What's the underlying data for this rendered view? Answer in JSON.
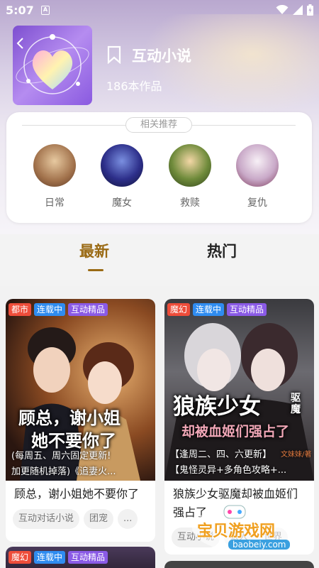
{
  "status": {
    "time": "5:07",
    "a_badge": "A"
  },
  "header": {
    "title": "互动小说",
    "count": "186本作品"
  },
  "recommend": {
    "title": "相关推荐",
    "items": [
      {
        "label": "日常"
      },
      {
        "label": "魔女"
      },
      {
        "label": "救赎"
      },
      {
        "label": "复仇"
      }
    ]
  },
  "tabs": {
    "latest": "最新",
    "hot": "热门"
  },
  "cards": [
    {
      "tags": [
        "都市",
        "连载中",
        "互动精品"
      ],
      "cover_title_1": "顾总，谢小姐",
      "cover_title_2": "她不要你了",
      "cover_sub_1": "(每周五、周六固定更新!",
      "cover_sub_2": "加更随机掉落)《追妻火...",
      "title": "顾总，谢小姐她不要你了",
      "chips": [
        "互动对话小说",
        "团宠",
        "..."
      ]
    },
    {
      "tags": [
        "魔幻",
        "连载中",
        "互动精品"
      ],
      "cover_title_1": "狼族少女",
      "cover_title_side": "驱魔",
      "cover_title_2": "却被血姬们强占了",
      "cover_sub_1": "【逢周二、四、六更新】",
      "cover_sub_author": "文妹妹/著",
      "cover_sub_2": "【鬼怪灵异+多角色攻略+...",
      "title": "狼族少女驱魔却被血姬们强占了",
      "chips": [
        "互动小说",
        "狼人",
        "世界"
      ]
    },
    {
      "tags": [
        "魔幻",
        "连载中",
        "互动精品"
      ]
    }
  ],
  "watermark": {
    "text": "宝贝游戏网",
    "url": "baobeiy.com"
  },
  "colors": {
    "accent": "#9a6a14",
    "tag_red": "#ee4d3a",
    "tag_blue": "#2f8cf0",
    "tag_purple": "#8a5ae6"
  }
}
